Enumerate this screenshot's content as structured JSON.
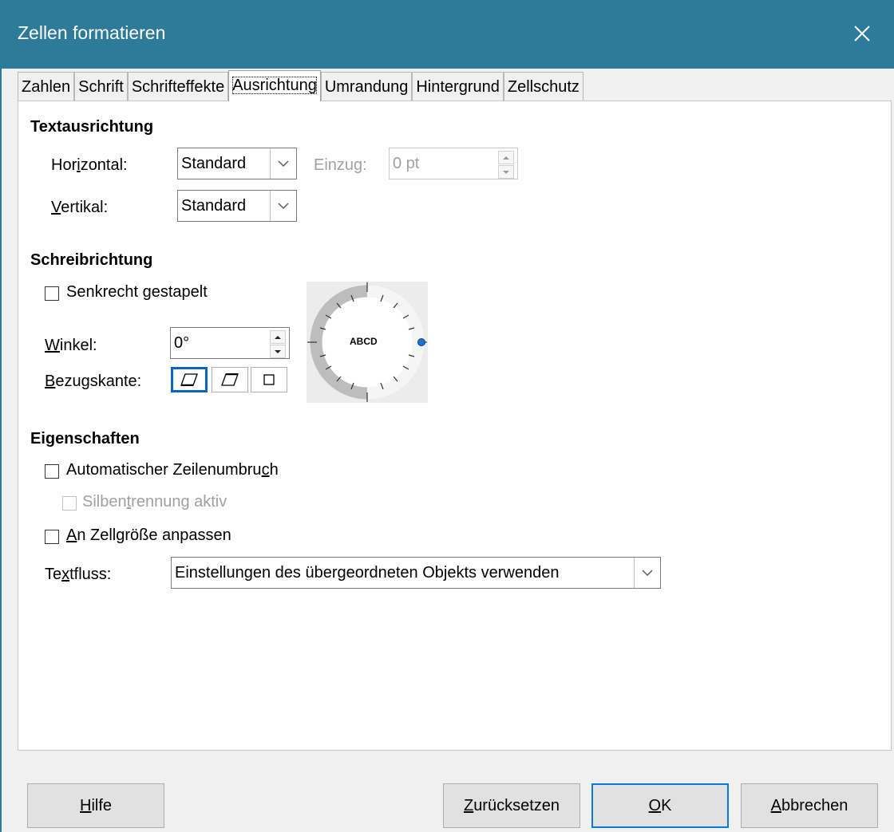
{
  "window": {
    "title": "Zellen formatieren",
    "close_icon": "close-icon"
  },
  "tabs": [
    {
      "label": "Zahlen"
    },
    {
      "label": "Schrift"
    },
    {
      "label": "Schrifteffekte"
    },
    {
      "label": "Ausrichtung",
      "active": true
    },
    {
      "label": "Umrandung"
    },
    {
      "label": "Hintergrund"
    },
    {
      "label": "Zellschutz"
    }
  ],
  "text_alignment": {
    "heading": "Textausrichtung",
    "horizontal": {
      "label_pre": "Hor",
      "label_u": "i",
      "label_post": "zontal:",
      "value": "Standard"
    },
    "indent": {
      "label_pre": "Einzu",
      "label_u": "g",
      "label_post": ":",
      "value": "0 pt"
    },
    "vertical": {
      "label_pre": "",
      "label_u": "V",
      "label_post": "ertikal:",
      "value": "Standard"
    }
  },
  "text_orientation": {
    "heading": "Schreibrichtung",
    "stacked": {
      "label_pre": "Senkrecht ",
      "label_u": "g",
      "label_post": "estapelt",
      "checked": false
    },
    "angle": {
      "label_pre": "",
      "label_u": "W",
      "label_post": "inkel:",
      "value": "0°"
    },
    "reference_edge": {
      "label_pre": "",
      "label_u": "B",
      "label_post": "ezugskante:"
    },
    "dial_text": "ABCD"
  },
  "properties": {
    "heading": "Eigenschaften",
    "wrap": {
      "label_pre": "Automatischer Zeilenumbru",
      "label_u": "c",
      "label_post": "h",
      "checked": false
    },
    "hyphenation": {
      "label_pre": "Silben",
      "label_u": "t",
      "label_post": "rennung aktiv",
      "checked": false,
      "disabled": true
    },
    "shrink": {
      "label_pre": "",
      "label_u": "A",
      "label_post": "n Zellgröße anpassen",
      "checked": false
    },
    "textflow": {
      "label_pre": "Te",
      "label_u": "x",
      "label_post": "tfluss:",
      "value": "Einstellungen des übergeordneten Objekts verwenden"
    }
  },
  "buttons": {
    "help": {
      "label_pre": "",
      "label_u": "H",
      "label_post": "ilfe"
    },
    "reset": {
      "label_pre": "",
      "label_u": "Z",
      "label_post": "urücksetzen"
    },
    "ok": {
      "label_pre": "",
      "label_u": "O",
      "label_post": "K"
    },
    "cancel": {
      "label_pre": "",
      "label_u": "A",
      "label_post": "bbrechen"
    }
  },
  "colors": {
    "titlebar": "#2e7a99",
    "accent": "#0a78d7"
  }
}
